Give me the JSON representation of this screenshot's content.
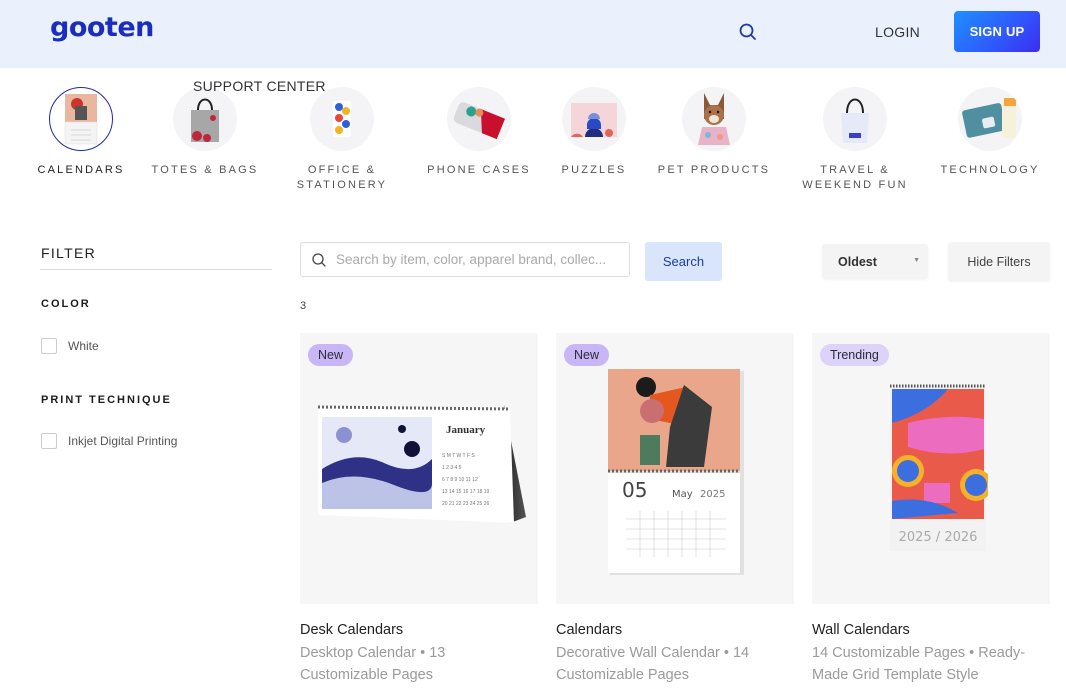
{
  "header": {
    "logo": "gooten",
    "login_label": "LOGIN",
    "signup_label": "SIGN UP",
    "support_label": "SUPPORT CENTER",
    "search_icon": "search-icon"
  },
  "categories": [
    {
      "label": "CALENDARS",
      "active": true
    },
    {
      "label": "TOTES & BAGS",
      "active": false
    },
    {
      "label": "OFFICE & STATIONERY",
      "active": false
    },
    {
      "label": "PHONE CASES",
      "active": false
    },
    {
      "label": "PUZZLES",
      "active": false
    },
    {
      "label": "PET PRODUCTS",
      "active": false
    },
    {
      "label": "TRAVEL & WEEKEND FUN",
      "active": false
    },
    {
      "label": "TECHNOLOGY",
      "active": false
    }
  ],
  "filter": {
    "title": "FILTER",
    "groups": [
      {
        "title": "COLOR",
        "options": [
          {
            "label": "White",
            "checked": false
          }
        ]
      },
      {
        "title": "PRINT TECHNIQUE",
        "options": [
          {
            "label": "Inkjet Digital Printing",
            "checked": false
          }
        ]
      }
    ]
  },
  "toolbar": {
    "search_placeholder": "Search by item, color, apparel brand, collec...",
    "search_value": "",
    "search_button": "Search",
    "sort_selected": "Oldest",
    "hide_filters": "Hide Filters",
    "result_count": "3"
  },
  "products": [
    {
      "badge": "New",
      "name": "Desk Calendars",
      "desc_line1": "Desktop Calendar • 13",
      "desc_line2": "Customizable Pages",
      "image_text": "January"
    },
    {
      "badge": "New",
      "name": "Calendars",
      "desc_line1": "Decorative Wall Calendar • 14",
      "desc_line2": "Customizable Pages",
      "image_day": "05",
      "image_month": "May",
      "image_year": "2025"
    },
    {
      "badge": "Trending",
      "name": "Wall Calendars",
      "desc_line1": "14 Customizable Pages • Ready-",
      "desc_line2": "Made Grid Template Style",
      "image_text": "2025 / 2026"
    }
  ],
  "colors": {
    "brand": "#1a2dbf",
    "header_bg": "#eaf1fc",
    "signup_start": "#1e90ff",
    "signup_end": "#3a2ef0",
    "badge_new": "#c9b6f7",
    "badge_trending": "#ddd2f8"
  }
}
